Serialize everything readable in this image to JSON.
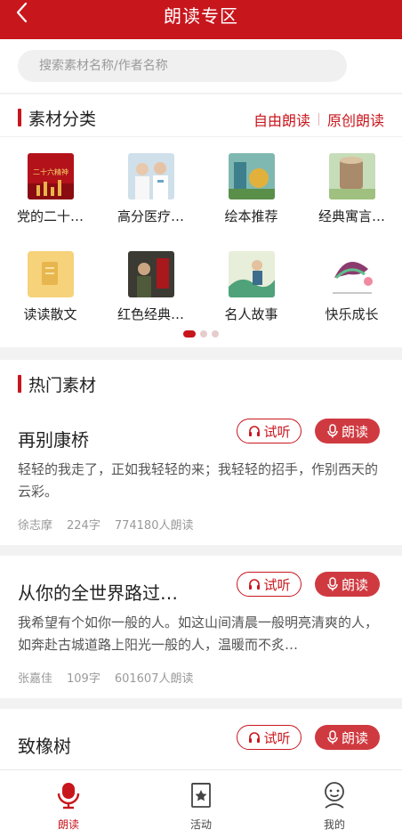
{
  "header": {
    "title": "朗读专区"
  },
  "search": {
    "placeholder": "搜索素材名称/作者名称"
  },
  "categories_section": {
    "title": "素材分类",
    "links": [
      "自由朗读",
      "原创朗读"
    ],
    "items": [
      {
        "label": "党的二十…",
        "thumb_text": "二十六精神"
      },
      {
        "label": "高分医疗…"
      },
      {
        "label": "绘本推荐"
      },
      {
        "label": "经典寓言…"
      },
      {
        "label": "读读散文"
      },
      {
        "label": "红色经典…"
      },
      {
        "label": "名人故事"
      },
      {
        "label": "快乐成长"
      }
    ],
    "pages": 3,
    "active_page": 1
  },
  "hot_section": {
    "title": "热门素材",
    "listen_label": "试听",
    "read_label": "朗读",
    "cards": [
      {
        "title": "再别康桥",
        "excerpt": "轻轻的我走了，正如我轻轻的来；我轻轻的招手，作别西天的云彩。",
        "author": "徐志摩",
        "words": "224字",
        "reads": "774180人朗读"
      },
      {
        "title": "从你的全世界路过…",
        "excerpt": "我希望有个如你一般的人。如这山间清晨一般明亮清爽的人，如奔赴古城道路上阳光一般的人，温暖而不炙…",
        "author": "张嘉佳",
        "words": "109字",
        "reads": "601607人朗读"
      },
      {
        "title": "致橡树"
      }
    ]
  },
  "tabbar": {
    "tabs": [
      {
        "label": "朗读",
        "icon": "microphone-icon",
        "active": true
      },
      {
        "label": "活动",
        "icon": "bookmark-star-icon",
        "active": false
      },
      {
        "label": "我的",
        "icon": "user-face-icon",
        "active": false
      }
    ]
  },
  "colors": {
    "accent": "#c8161d",
    "read_button": "#cf3a40"
  }
}
